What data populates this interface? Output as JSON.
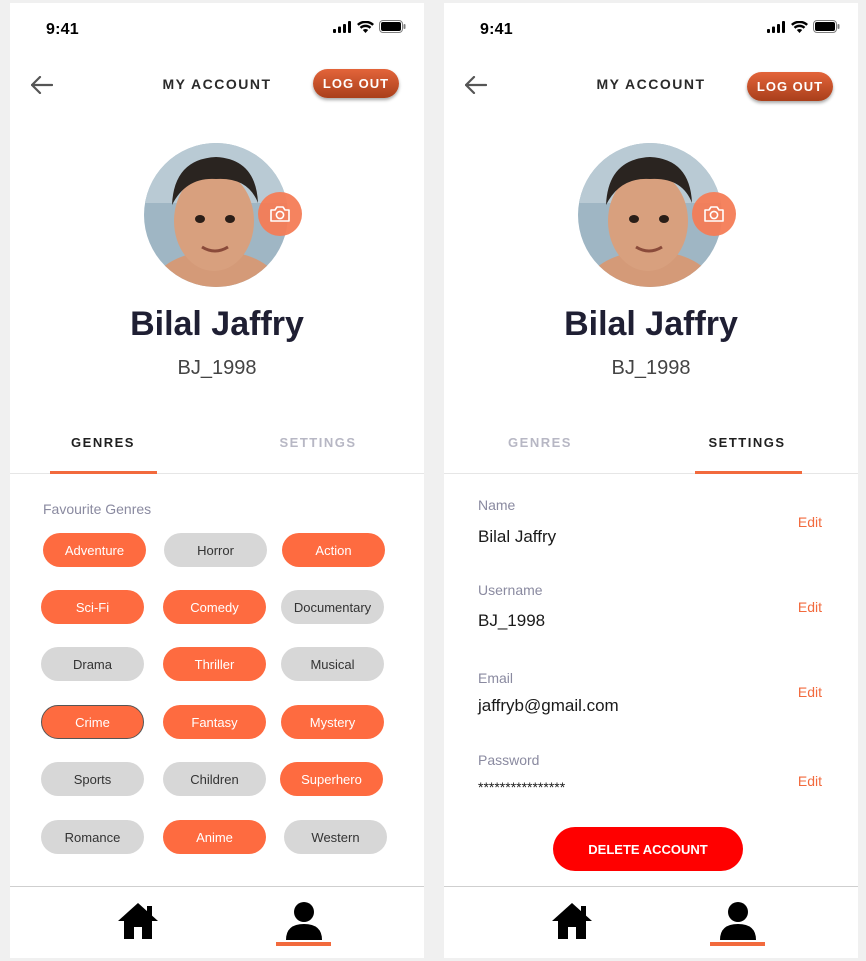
{
  "status": {
    "time": "9:41"
  },
  "header": {
    "title": "MY ACCOUNT",
    "logout_label": "LOG OUT"
  },
  "profile": {
    "name": "Bilal Jaffry",
    "username": "BJ_1998"
  },
  "tabs": {
    "genres": "GENRES",
    "settings": "SETTINGS"
  },
  "genres": {
    "label": "Favourite Genres",
    "items": [
      {
        "label": "Adventure",
        "selected": true
      },
      {
        "label": "Horror",
        "selected": false
      },
      {
        "label": "Action",
        "selected": true
      },
      {
        "label": "Sci-Fi",
        "selected": true
      },
      {
        "label": "Comedy",
        "selected": true
      },
      {
        "label": "Documentary",
        "selected": false
      },
      {
        "label": "Drama",
        "selected": false
      },
      {
        "label": "Thriller",
        "selected": true
      },
      {
        "label": "Musical",
        "selected": false
      },
      {
        "label": "Crime",
        "selected": true
      },
      {
        "label": "Fantasy",
        "selected": true
      },
      {
        "label": "Mystery",
        "selected": true
      },
      {
        "label": "Sports",
        "selected": false
      },
      {
        "label": "Children",
        "selected": false
      },
      {
        "label": "Superhero",
        "selected": true
      },
      {
        "label": "Romance",
        "selected": false
      },
      {
        "label": "Anime",
        "selected": true
      },
      {
        "label": "Western",
        "selected": false
      }
    ]
  },
  "settings": {
    "fields": [
      {
        "label": "Name",
        "value": "Bilal Jaffry",
        "edit": "Edit"
      },
      {
        "label": "Username",
        "value": "BJ_1998",
        "edit": "Edit"
      },
      {
        "label": "Email",
        "value": "jaffryb@gmail.com",
        "edit": "Edit"
      },
      {
        "label": "Password",
        "value": "****************",
        "edit": "Edit"
      }
    ],
    "delete_label": "DELETE ACCOUNT"
  },
  "colors": {
    "accent": "#f26a3d",
    "chip_on": "#fe6b40",
    "chip_off": "#d7d7d7",
    "danger": "#ff0000"
  },
  "icons": [
    "back-arrow-icon",
    "camera-icon",
    "home-icon",
    "user-icon",
    "signal-icon",
    "wifi-icon",
    "battery-icon"
  ]
}
